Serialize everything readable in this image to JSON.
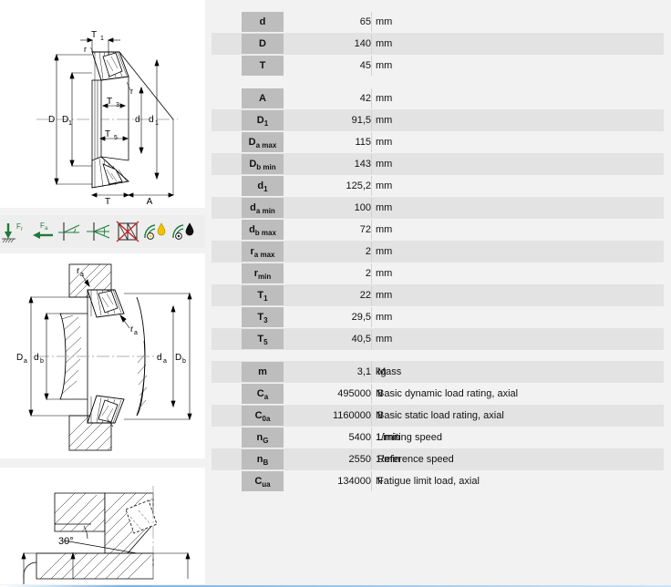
{
  "product": {
    "type": "spherical-roller-thrust-bearing",
    "contact_angle_label": "30°"
  },
  "drawings": {
    "main": {
      "name": "bearing-cross-section",
      "dimension_labels": [
        "T₁",
        "r",
        "r",
        "D",
        "D₁",
        "T₃",
        "T₅",
        "d",
        "d₁",
        "T",
        "A"
      ]
    },
    "mounting": {
      "name": "mounting-dimensions",
      "dimension_labels": [
        "rₐ",
        "rₐ",
        "Dₐ",
        "d_b",
        "dₐ",
        "D_b"
      ]
    },
    "angle": {
      "name": "contact-angle-detail",
      "angle": "30°"
    }
  },
  "icons": [
    {
      "name": "radial-load-icon",
      "label": "Fr"
    },
    {
      "name": "axial-load-icon",
      "label": "Fa"
    },
    {
      "name": "angular-adjustable-icon",
      "label": ""
    },
    {
      "name": "misalignment-icon",
      "label": ""
    },
    {
      "name": "non-separable-icon",
      "label": ""
    },
    {
      "name": "grease-lubrication-icon",
      "label": ""
    },
    {
      "name": "oil-lubrication-icon",
      "label": ""
    }
  ],
  "sections": [
    {
      "id": "principal-dimensions",
      "rows": [
        {
          "symbol": "d",
          "sub": "",
          "value": "65",
          "unit": "mm",
          "desc": ""
        },
        {
          "symbol": "D",
          "sub": "",
          "value": "140",
          "unit": "mm",
          "desc": ""
        },
        {
          "symbol": "T",
          "sub": "",
          "value": "45",
          "unit": "mm",
          "desc": ""
        }
      ]
    },
    {
      "id": "geometry-dimensions",
      "rows": [
        {
          "symbol": "A",
          "sub": "",
          "value": "42",
          "unit": "mm",
          "desc": ""
        },
        {
          "symbol": "D",
          "sub": "1",
          "value": "91,5",
          "unit": "mm",
          "desc": ""
        },
        {
          "symbol": "D",
          "sub": "a max",
          "value": "115",
          "unit": "mm",
          "desc": ""
        },
        {
          "symbol": "D",
          "sub": "b min",
          "value": "143",
          "unit": "mm",
          "desc": ""
        },
        {
          "symbol": "d",
          "sub": "1",
          "value": "125,2",
          "unit": "mm",
          "desc": ""
        },
        {
          "symbol": "d",
          "sub": "a min",
          "value": "100",
          "unit": "mm",
          "desc": ""
        },
        {
          "symbol": "d",
          "sub": "b max",
          "value": "72",
          "unit": "mm",
          "desc": ""
        },
        {
          "symbol": "r",
          "sub": "a max",
          "value": "2",
          "unit": "mm",
          "desc": ""
        },
        {
          "symbol": "r",
          "sub": "min",
          "value": "2",
          "unit": "mm",
          "desc": ""
        },
        {
          "symbol": "T",
          "sub": "1",
          "value": "22",
          "unit": "mm",
          "desc": ""
        },
        {
          "symbol": "T",
          "sub": "3",
          "value": "29,5",
          "unit": "mm",
          "desc": ""
        },
        {
          "symbol": "T",
          "sub": "5",
          "value": "40,5",
          "unit": "mm",
          "desc": ""
        }
      ]
    },
    {
      "id": "performance-data",
      "rows": [
        {
          "symbol": "m",
          "sub": "",
          "value": "3,1",
          "unit": "kg",
          "desc": "Mass"
        },
        {
          "symbol": "C",
          "sub": "a",
          "value": "495000",
          "unit": "N",
          "desc": "Basic dynamic load rating, axial"
        },
        {
          "symbol": "C",
          "sub": "0a",
          "value": "1160000",
          "unit": "N",
          "desc": "Basic static load rating, axial"
        },
        {
          "symbol": "n",
          "sub": "G",
          "value": "5400",
          "unit": "1/min",
          "desc": "Limiting speed"
        },
        {
          "symbol": "n",
          "sub": "B",
          "value": "2550",
          "unit": "1/min",
          "desc": "Reference speed"
        },
        {
          "symbol": "C",
          "sub": "ua",
          "value": "134000",
          "unit": "N",
          "desc": "Fatigue limit load, axial"
        }
      ]
    }
  ],
  "colors": {
    "page_background": "#f2f2f2",
    "panel_background": "#ffffff",
    "label_cell": "#bdbdbd",
    "row_alt": "#e3e3e3",
    "icon_green": "#1d7a3c",
    "icon_red": "#cc2222",
    "icon_yellow": "#f2c400"
  }
}
